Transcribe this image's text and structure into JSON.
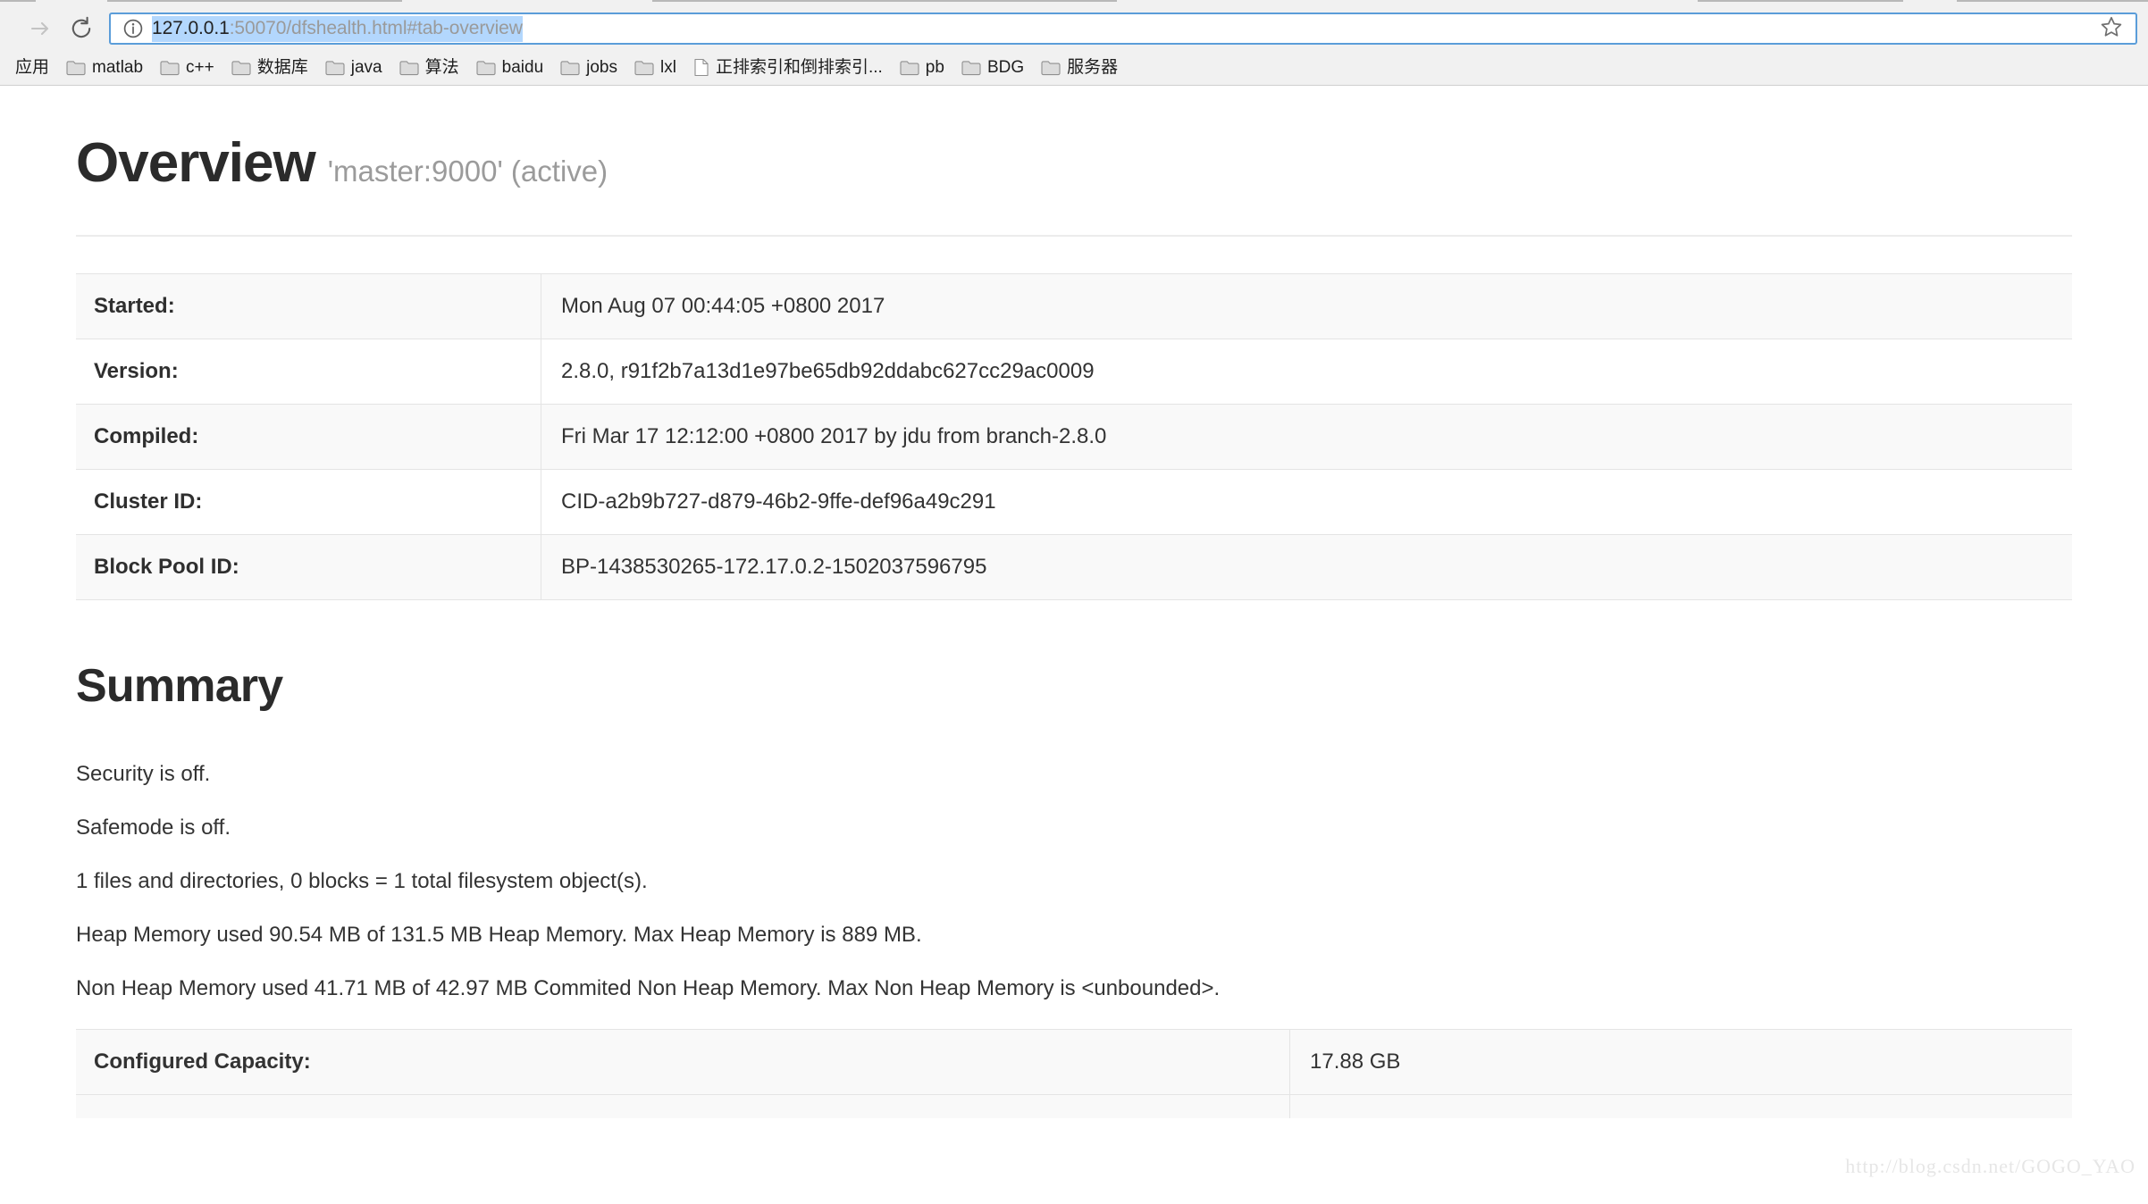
{
  "browser": {
    "forward_icon": "arrow-right-icon",
    "reload_icon": "reload-icon",
    "info_icon": "info-circle-icon",
    "star_icon": "star-icon",
    "url_host": "127.0.0.1",
    "url_rest": ":50070/dfshealth.html#tab-overview",
    "url_full": "127.0.0.1:50070/dfshealth.html#tab-overview",
    "bookmarks": [
      {
        "label": "应用",
        "icon": "none"
      },
      {
        "label": "matlab",
        "icon": "folder-icon"
      },
      {
        "label": "c++",
        "icon": "folder-icon"
      },
      {
        "label": "数据库",
        "icon": "folder-icon"
      },
      {
        "label": "java",
        "icon": "folder-icon"
      },
      {
        "label": "算法",
        "icon": "folder-icon"
      },
      {
        "label": "baidu",
        "icon": "folder-icon"
      },
      {
        "label": "jobs",
        "icon": "folder-icon"
      },
      {
        "label": "lxl",
        "icon": "folder-icon"
      },
      {
        "label": "正排索引和倒排索引...",
        "icon": "page-icon"
      },
      {
        "label": "pb",
        "icon": "folder-icon"
      },
      {
        "label": "BDG",
        "icon": "folder-icon"
      },
      {
        "label": "服务器",
        "icon": "folder-icon"
      }
    ]
  },
  "page": {
    "title": "Overview",
    "subtitle": "'master:9000' (active)",
    "info_table": [
      {
        "key": "Started:",
        "value": "Mon Aug 07 00:44:05 +0800 2017"
      },
      {
        "key": "Version:",
        "value": "2.8.0, r91f2b7a13d1e97be65db92ddabc627cc29ac0009"
      },
      {
        "key": "Compiled:",
        "value": "Fri Mar 17 12:12:00 +0800 2017 by jdu from branch-2.8.0"
      },
      {
        "key": "Cluster ID:",
        "value": "CID-a2b9b727-d879-46b2-9ffe-def96a49c291"
      },
      {
        "key": "Block Pool ID:",
        "value": "BP-1438530265-172.17.0.2-1502037596795"
      }
    ],
    "summary_heading": "Summary",
    "summary_lines": [
      "Security is off.",
      "Safemode is off.",
      "1 files and directories, 0 blocks = 1 total filesystem object(s).",
      "Heap Memory used 90.54 MB of 131.5 MB Heap Memory. Max Heap Memory is 889 MB.",
      "Non Heap Memory used 41.71 MB of 42.97 MB Commited Non Heap Memory. Max Non Heap Memory is <unbounded>."
    ],
    "capacity_table": [
      {
        "key": "Configured Capacity:",
        "value": "17.88 GB"
      }
    ],
    "watermark": "http://blog.csdn.net/GOGO_YAO"
  },
  "colors": {
    "omnibox_focus": "#5b9dd9",
    "url_selection": "#b3d7fd",
    "chrome_bg": "#f1f1f1",
    "table_stripe": "#f9f9f9",
    "table_border": "#e4e4e4"
  }
}
